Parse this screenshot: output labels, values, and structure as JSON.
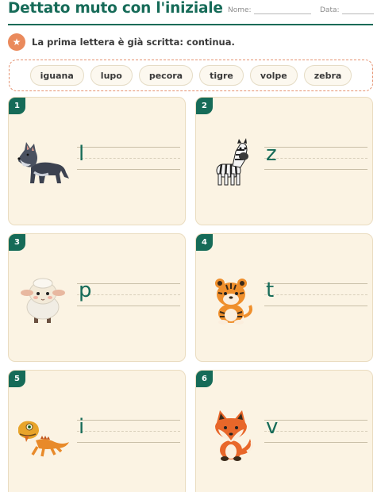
{
  "header": {
    "title": "Dettato muto con l'iniziale",
    "name_label": "Nome:",
    "date_label": "Data:",
    "accent_color": "#166b58"
  },
  "instruction": {
    "icon": "star-icon",
    "text": "La prima lettera è già scritta: continua."
  },
  "word_bank": [
    "iguana",
    "lupo",
    "pecora",
    "tigre",
    "volpe",
    "zebra"
  ],
  "cards": [
    {
      "number": "1",
      "animal": "wolf",
      "letter": "l"
    },
    {
      "number": "2",
      "animal": "zebra",
      "letter": "z"
    },
    {
      "number": "3",
      "animal": "sheep",
      "letter": "p"
    },
    {
      "number": "4",
      "animal": "tiger",
      "letter": "t"
    },
    {
      "number": "5",
      "animal": "iguana",
      "letter": "i"
    },
    {
      "number": "6",
      "animal": "fox",
      "letter": "v"
    }
  ]
}
